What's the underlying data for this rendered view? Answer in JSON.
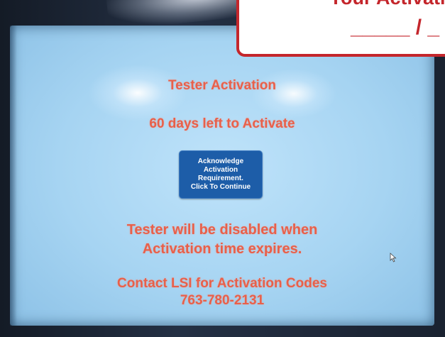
{
  "screen": {
    "title": "Tester Activation",
    "days_left": "60 days left to Activate",
    "button_lines": [
      "Acknowledge",
      "Activation",
      "Requirement.",
      "Click To Continue"
    ],
    "warning_lines": [
      "Tester will be disabled when",
      "Activation time expires."
    ],
    "contact_lines": [
      "Contact LSI for Activation Codes",
      "763-780-2131"
    ]
  },
  "callout": {
    "line1": "Your Activati",
    "line2": "_____ / _"
  },
  "colors": {
    "message_text": "#e8604a",
    "button_bg": "#1d5da8",
    "callout_border": "#c4262c"
  },
  "icons": {
    "cursor": "mouse-cursor-icon"
  }
}
